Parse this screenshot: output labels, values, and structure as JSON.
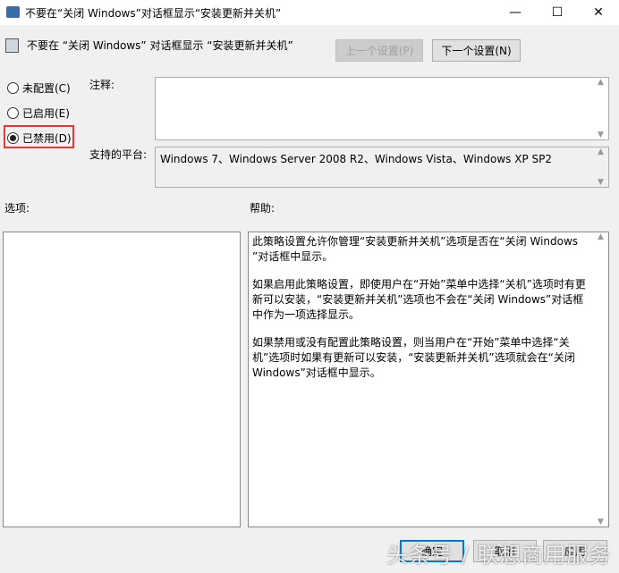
{
  "window": {
    "title": "不要在“关闭 Windows”对话框显示“安装更新并关机”",
    "minimize": "—",
    "maximize": "☐",
    "close": "✕"
  },
  "header": {
    "policy_name": "不要在 “关闭 Windows” 对话框显示 “安装更新并关机”",
    "prev_button": "上一个设置(P)",
    "next_button": "下一个设置(N)"
  },
  "options": [
    {
      "label": "未配置(C)",
      "checked": false
    },
    {
      "label": "已启用(E)",
      "checked": false
    },
    {
      "label": "已禁用(D)",
      "checked": true
    }
  ],
  "comment_label": "注释:",
  "comment_value": "",
  "platform_label": "支持的平台:",
  "platform_value": "Windows 7、Windows Server 2008 R2、Windows Vista、Windows XP SP2",
  "options_label": "选项:",
  "help_label": "帮助:",
  "help_paragraphs": [
    "此策略设置允许你管理“安装更新并关机”选项是否在“关闭 Windows ”对话框中显示。",
    "如果启用此策略设置，即使用户在“开始”菜单中选择“关机”选项时有更新可以安装，“安装更新并关机”选项也不会在“关闭 Windows”对话框中作为一项选择显示。",
    "如果禁用或没有配置此策略设置，则当用户在“开始”菜单中选择“关机”选项时如果有更新可以安装，“安装更新并关机”选项就会在“关闭 Windows”对话框中显示。"
  ],
  "footer": {
    "ok": "确定",
    "cancel": "取消",
    "apply": "应用"
  },
  "watermark": "头条号 / 联想商用服务"
}
